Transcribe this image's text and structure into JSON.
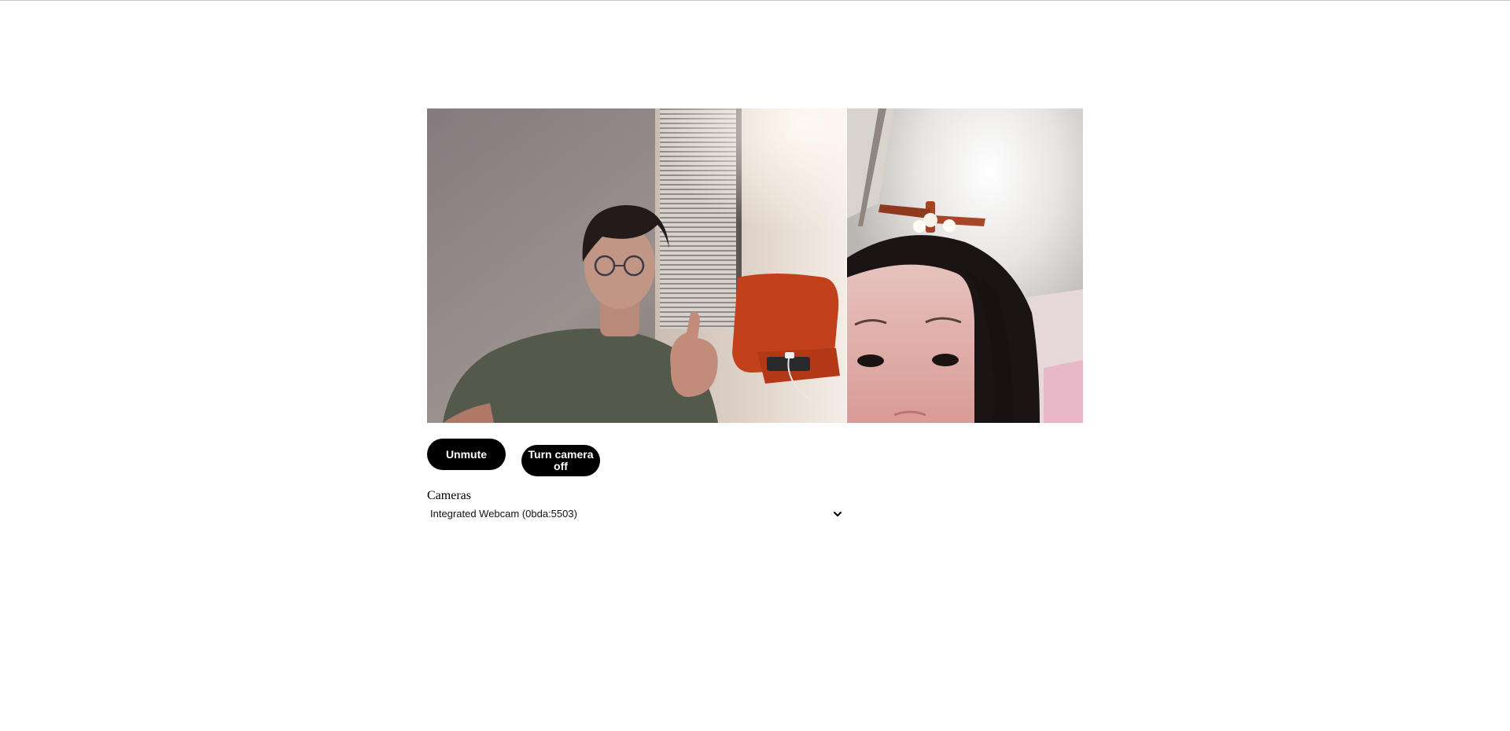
{
  "controls": {
    "mute_label": "Unmute",
    "camera_label": "Turn camera off"
  },
  "cameras": {
    "label": "Cameras",
    "selected": "Integrated Webcam (0bda:5503)"
  },
  "icons": {
    "select_arrow": "chevron-down-icon"
  }
}
